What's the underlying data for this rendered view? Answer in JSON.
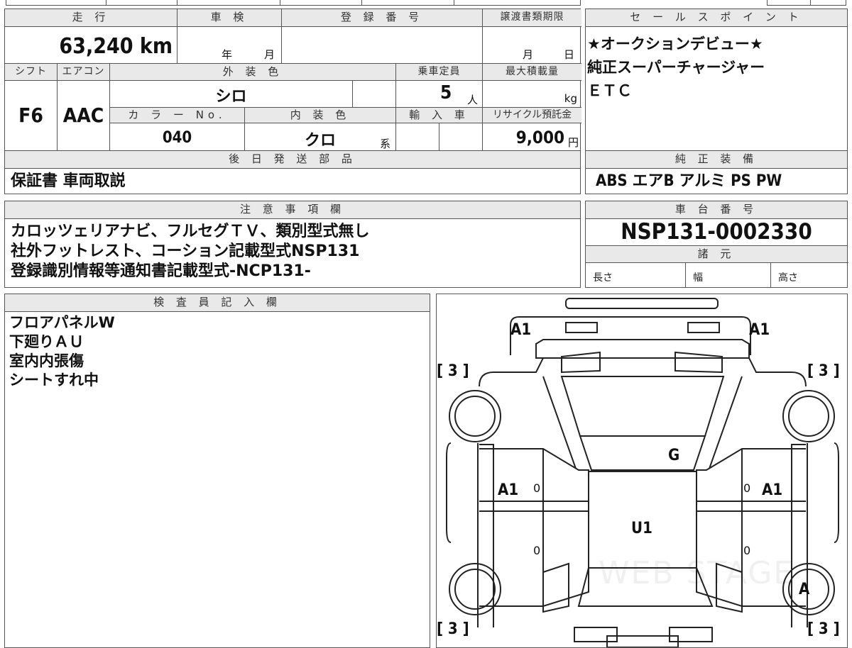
{
  "top_strip": [
    "",
    "",
    "",
    "",
    "",
    ""
  ],
  "mileage": {
    "label": "走 行",
    "value": "63,240 km"
  },
  "inspection": {
    "label": "車 検",
    "year_unit": "年",
    "month_unit": "月"
  },
  "registration": {
    "label": "登 録 番 号",
    "value": ""
  },
  "transfer_deadline": {
    "label": "譲渡書類期限",
    "month_unit": "月",
    "day_unit": "日"
  },
  "shift": {
    "label": "シフト",
    "value": "F6"
  },
  "aircon": {
    "label": "エアコン",
    "value": "AAC"
  },
  "exterior_color": {
    "label": "外 装 色",
    "value": "シロ"
  },
  "capacity": {
    "label": "乗車定員",
    "value": "5",
    "unit": "人"
  },
  "max_load": {
    "label": "最大積載量",
    "value": "",
    "unit": "kg"
  },
  "color_no": {
    "label": "カ ラ ー No.",
    "value": "040"
  },
  "interior_color": {
    "label": "内 装 色",
    "value": "クロ",
    "suffix": "系"
  },
  "import": {
    "label": "輸 入 車"
  },
  "recycle_fee": {
    "label": "リサイクル預託金",
    "value": "9,000",
    "unit": "円"
  },
  "later_shipping": {
    "label": "後 日 発 送 部 品",
    "value": "保証書 車両取説"
  },
  "sales_points": {
    "label": "セ ー ル ス ポ イ ン ト",
    "lines": [
      "★オークションデビュー★",
      "純正スーパーチャージャー",
      "ＥＴＣ"
    ]
  },
  "genuine_equipment": {
    "label": "純 正 装 備",
    "value": "ABS エアB アルミ PS PW"
  },
  "notes": {
    "label": "注 意 事 項 欄",
    "lines": [
      "カロッツェリアナビ、フルセグＴＶ、類別型式無し",
      "社外フットレスト、コーション記載型式NSP131",
      "登録識別情報等通知書記載型式-NCP131-"
    ]
  },
  "chassis_number": {
    "label": "車 台 番 号",
    "value": "NSP131-0002330"
  },
  "specs": {
    "label": "諸 元",
    "length": "長さ",
    "width": "幅",
    "height": "高さ"
  },
  "inspector": {
    "label": "検 査 員 記 入 欄",
    "lines": [
      "フロアパネルW",
      "下廻りＡＵ",
      "室内内張傷",
      "シートすれ中"
    ]
  },
  "diagram": {
    "front_left": "A1",
    "front_right": "A1",
    "corner_tl": "[ 3 ]",
    "corner_tr": "[ 3 ]",
    "corner_bl": "[ 3 ]",
    "corner_br": "[ 3 ]",
    "roof": "G",
    "door_left": "A1",
    "door_right": "A1",
    "center": "U1",
    "rear_right_wheel": "A",
    "marks": [
      "0",
      "0",
      "0",
      "0"
    ],
    "watermark": "WEB STAGE"
  }
}
